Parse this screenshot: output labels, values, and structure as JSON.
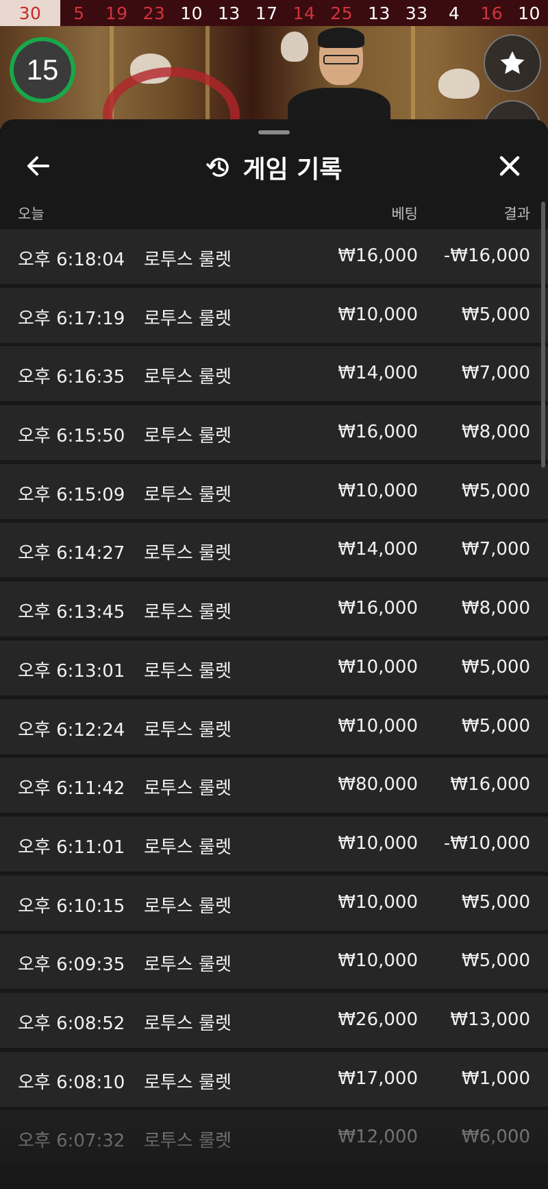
{
  "history_strip": [
    {
      "value": "30",
      "color": "red"
    },
    {
      "value": "5",
      "color": "red"
    },
    {
      "value": "19",
      "color": "red"
    },
    {
      "value": "23",
      "color": "red"
    },
    {
      "value": "10",
      "color": "black"
    },
    {
      "value": "13",
      "color": "black"
    },
    {
      "value": "17",
      "color": "black"
    },
    {
      "value": "14",
      "color": "red"
    },
    {
      "value": "25",
      "color": "red"
    },
    {
      "value": "13",
      "color": "black"
    },
    {
      "value": "33",
      "color": "black"
    },
    {
      "value": "4",
      "color": "black"
    },
    {
      "value": "16",
      "color": "red"
    },
    {
      "value": "10",
      "color": "black"
    }
  ],
  "timer": {
    "value": "15"
  },
  "icons": {
    "favorite": "star-icon",
    "back": "arrow-left-icon",
    "history": "history-icon",
    "close": "close-icon"
  },
  "header": {
    "title": "게임 기록"
  },
  "columns": {
    "today": "오늘",
    "bet": "베팅",
    "result": "결과"
  },
  "rows": [
    {
      "time": "오후 6:18:04",
      "game": "로투스 룰렛",
      "bet": "₩16,000",
      "result": "-₩16,000"
    },
    {
      "time": "오후 6:17:19",
      "game": "로투스 룰렛",
      "bet": "₩10,000",
      "result": "₩5,000"
    },
    {
      "time": "오후 6:16:35",
      "game": "로투스 룰렛",
      "bet": "₩14,000",
      "result": "₩7,000"
    },
    {
      "time": "오후 6:15:50",
      "game": "로투스 룰렛",
      "bet": "₩16,000",
      "result": "₩8,000"
    },
    {
      "time": "오후 6:15:09",
      "game": "로투스 룰렛",
      "bet": "₩10,000",
      "result": "₩5,000"
    },
    {
      "time": "오후 6:14:27",
      "game": "로투스 룰렛",
      "bet": "₩14,000",
      "result": "₩7,000"
    },
    {
      "time": "오후 6:13:45",
      "game": "로투스 룰렛",
      "bet": "₩16,000",
      "result": "₩8,000"
    },
    {
      "time": "오후 6:13:01",
      "game": "로투스 룰렛",
      "bet": "₩10,000",
      "result": "₩5,000"
    },
    {
      "time": "오후 6:12:24",
      "game": "로투스 룰렛",
      "bet": "₩10,000",
      "result": "₩5,000"
    },
    {
      "time": "오후 6:11:42",
      "game": "로투스 룰렛",
      "bet": "₩80,000",
      "result": "₩16,000"
    },
    {
      "time": "오후 6:11:01",
      "game": "로투스 룰렛",
      "bet": "₩10,000",
      "result": "-₩10,000"
    },
    {
      "time": "오후 6:10:15",
      "game": "로투스 룰렛",
      "bet": "₩10,000",
      "result": "₩5,000"
    },
    {
      "time": "오후 6:09:35",
      "game": "로투스 룰렛",
      "bet": "₩10,000",
      "result": "₩5,000"
    },
    {
      "time": "오후 6:08:52",
      "game": "로투스 룰렛",
      "bet": "₩26,000",
      "result": "₩13,000"
    },
    {
      "time": "오후 6:08:10",
      "game": "로투스 룰렛",
      "bet": "₩17,000",
      "result": "₩1,000"
    },
    {
      "time": "오후 6:07:32",
      "game": "로투스 룰렛",
      "bet": "₩12,000",
      "result": "₩6,000"
    }
  ]
}
